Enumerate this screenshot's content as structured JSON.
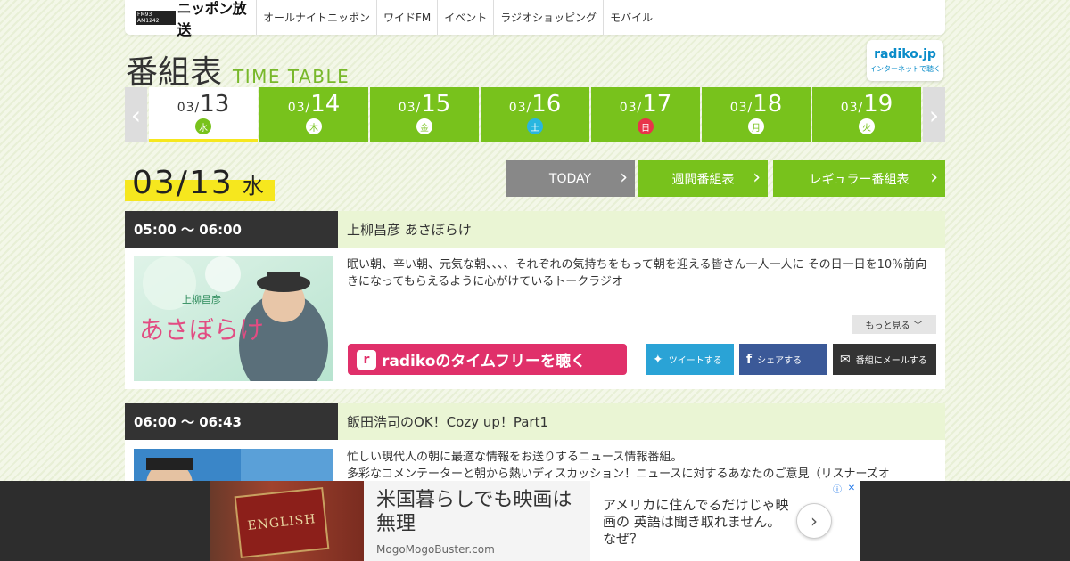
{
  "header": {
    "logo_freq": "FM93 AM1242",
    "logo_name": "ニッポン放送",
    "nav": [
      "オールナイトニッポン",
      "ワイドFM",
      "イベント",
      "ラジオショッピング",
      "モバイル"
    ]
  },
  "title": {
    "ja": "番組表",
    "en": "TIME TABLE"
  },
  "radiko_badge": {
    "logo": "radiko.jp",
    "caption": "インターネットで聴く"
  },
  "tabs": [
    {
      "mm": "03/",
      "dd": "13",
      "dow": "水",
      "active": true
    },
    {
      "mm": "03/",
      "dd": "14",
      "dow": "木"
    },
    {
      "mm": "03/",
      "dd": "15",
      "dow": "金"
    },
    {
      "mm": "03/",
      "dd": "16",
      "dow": "土",
      "dow_color": "#29b6e0"
    },
    {
      "mm": "03/",
      "dd": "17",
      "dow": "日",
      "dow_color": "#e8344a"
    },
    {
      "mm": "03/",
      "dd": "18",
      "dow": "月"
    },
    {
      "mm": "03/",
      "dd": "19",
      "dow": "火"
    }
  ],
  "date_heading": {
    "date": "03/13",
    "dow": "水"
  },
  "actions": {
    "today": "TODAY",
    "weekly": "週間番組表",
    "regular": "レギュラー番組表"
  },
  "programs": [
    {
      "time": "05:00 ～ 06:00",
      "title": "上柳昌彦 あさぼらけ",
      "image_text": "あさぼらけ",
      "image_sub": "上柳昌彦",
      "desc": "眠い朝、辛い朝、元気な朝、、、、それぞれの気持ちをもって朝を迎える皆さん一人一人に その日一日を10％前向きになってもらえるように心がけているトークラジオ",
      "more": "もっと見る",
      "radiko": "radikoのタイムフリーを聴く",
      "tweet": "ツイートする",
      "share": "シェアする",
      "mail": "番組にメールする"
    },
    {
      "time": "06:00 ～ 06:43",
      "title": "飯田浩司のOK！Cozy up！Part1",
      "desc1": "忙しい現代人の朝に最適な情報をお送りするニュース情報番組。",
      "desc2": "多彩なコメンテーターと朝から熱いディスカッション！ニュースに対するあなたのご意見（リスナーズオ"
    }
  ],
  "ad": {
    "book_text": "ENGLISH",
    "headline": "米国暮らしでも映画は無理",
    "source": "MogoMogoBuster.com",
    "body": "アメリカに住んでるだけじゃ映画の 英語は聞き取れません。なぜ？"
  }
}
